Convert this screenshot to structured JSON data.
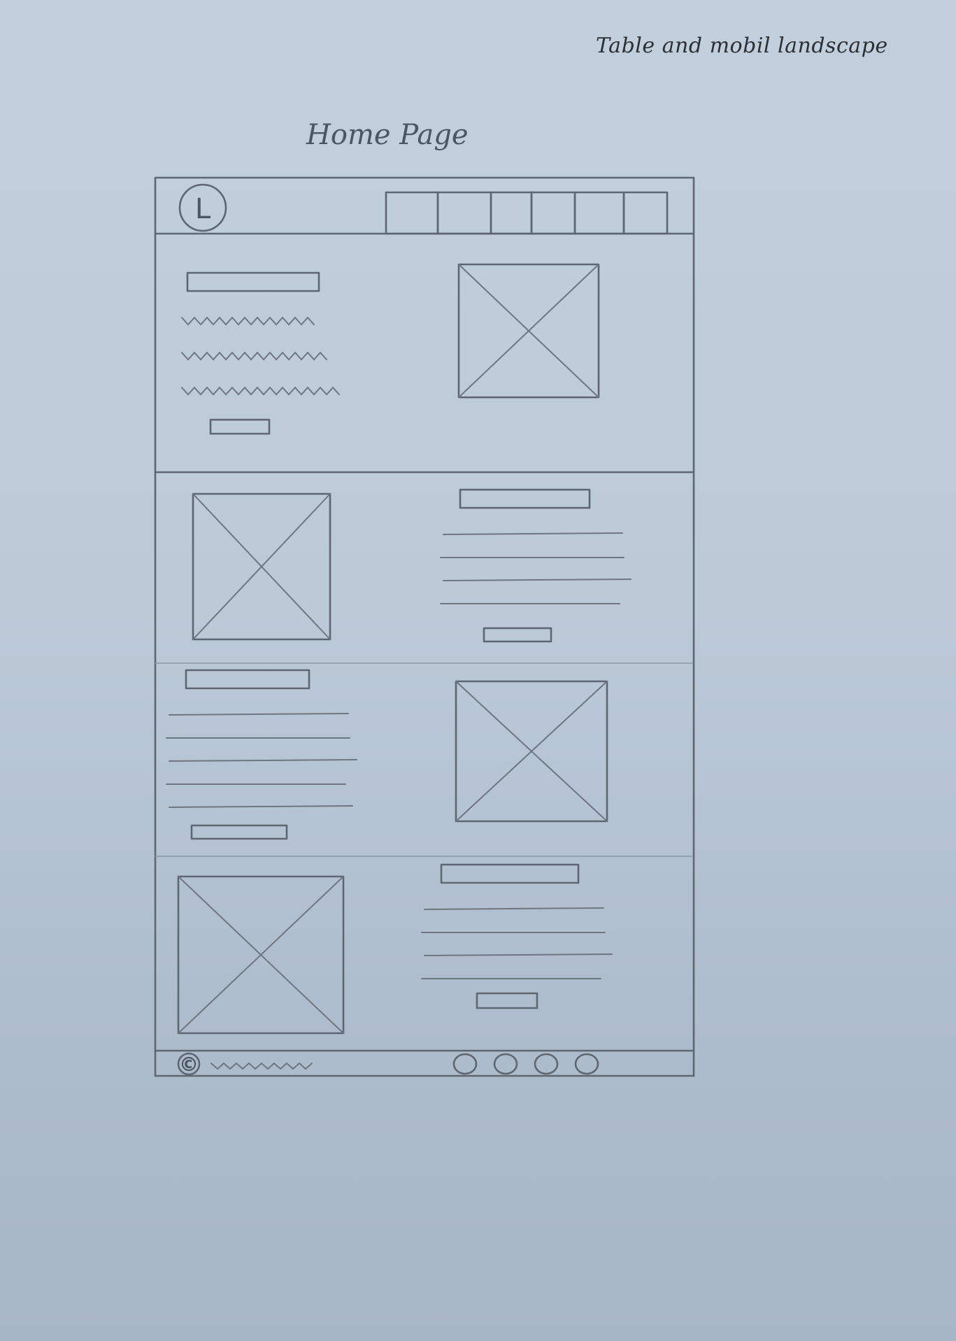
{
  "sketch": {
    "corner_note": "Table and mobil landscape",
    "page_title": "Home Page",
    "header": {
      "logo_letter": "L",
      "nav_tabs": 6,
      "active_tab": 1
    },
    "sections": [
      {
        "order": [
          "text",
          "image"
        ],
        "text_style": "squiggle",
        "text_lines": 3
      },
      {
        "order": [
          "image",
          "text"
        ],
        "text_style": "lines",
        "text_lines": 4
      },
      {
        "order": [
          "text",
          "image"
        ],
        "text_style": "lines",
        "text_lines": 5
      },
      {
        "order": [
          "image",
          "text"
        ],
        "text_style": "lines",
        "text_lines": 4
      }
    ],
    "footer": {
      "copyright_symbol": "©",
      "social_icons": 4
    }
  }
}
